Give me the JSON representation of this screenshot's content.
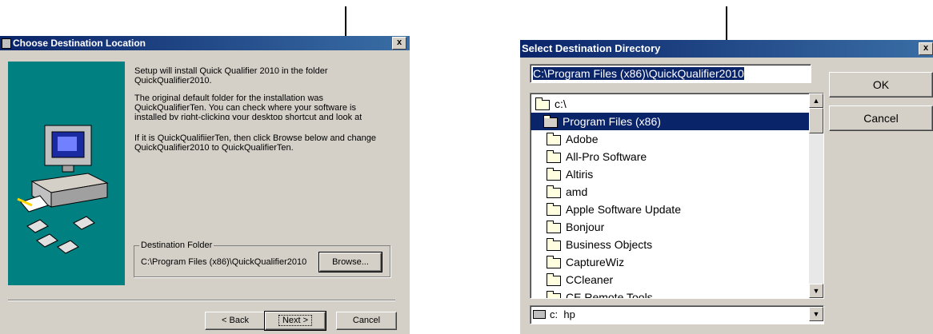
{
  "left_dialog": {
    "title": "Choose Destination Location",
    "close_label": "x",
    "paragraphs": [
      "Setup will install Quick Qualifier 2010 in the folder\nQuickQualifier2010.",
      "The original default folder for the installation was\nQuickQualifierTen. You can check where your software is\ninstalled by right-clicking your desktop shortcut and look at\nProperties.",
      "If it is QuickQualifiierTen, then click Browse below and change\nQuickQualifier2010 to QuickQualifierTen."
    ],
    "destination_group_label": "Destination Folder",
    "destination_path": "C:\\Program Files (x86)\\QuickQualifier2010",
    "browse_label": "Browse...",
    "back_label": "< Back",
    "next_label": "Next >",
    "cancel_label": "Cancel"
  },
  "right_dialog": {
    "title": "Select Destination Directory",
    "close_label": "x",
    "path_value": "C:\\Program Files (x86)\\QuickQualifier2010",
    "ok_label": "OK",
    "cancel_label": "Cancel",
    "folders": [
      "c:\\",
      "Program Files (x86)",
      "Adobe",
      "All-Pro Software",
      "Altiris",
      "amd",
      "Apple Software Update",
      "Bonjour",
      "Business Objects",
      "CaptureWiz",
      "CCleaner",
      "CE Remote Tools"
    ],
    "selected_folder": "Program Files (x86)",
    "drive_label": "c:  hp"
  }
}
